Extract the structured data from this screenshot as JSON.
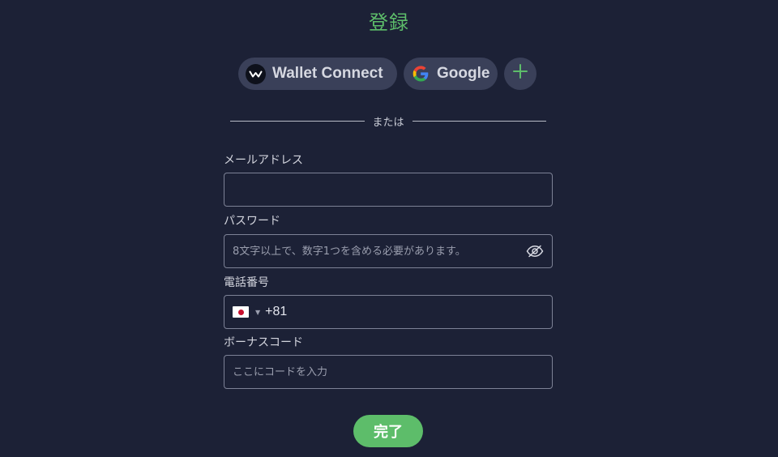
{
  "page": {
    "title": "登録"
  },
  "social": {
    "wallet_connect": {
      "label": "Wallet Connect",
      "icon": "wallet-connect-icon"
    },
    "google": {
      "label": "Google",
      "icon": "google-icon"
    },
    "more": {
      "icon": "plus-icon"
    }
  },
  "divider": {
    "text": "または"
  },
  "form": {
    "email": {
      "label": "メールアドレス",
      "value": "",
      "placeholder": ""
    },
    "password": {
      "label": "パスワード",
      "value": "",
      "placeholder": "8文字以上で、数字1つを含める必要があります。",
      "toggle_icon": "eye-icon"
    },
    "phone": {
      "label": "電話番号",
      "country_flag": "japan-flag-icon",
      "dial_code": "+81",
      "value": ""
    },
    "bonus": {
      "label": "ボーナスコード",
      "value": "",
      "placeholder": "ここにコードを入力"
    }
  },
  "submit": {
    "label": "完了"
  },
  "colors": {
    "background": "#1c2136",
    "accent": "#5dbd6a",
    "pill": "#3a4059"
  }
}
